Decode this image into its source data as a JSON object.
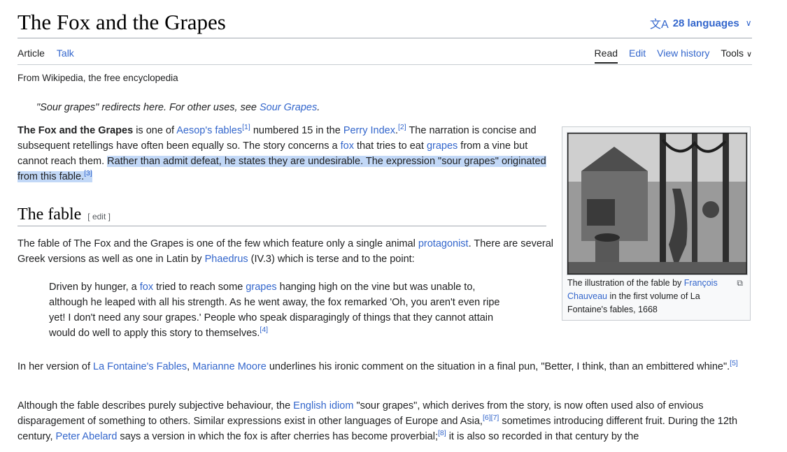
{
  "article": {
    "title": "The Fox and the Grapes",
    "languages_label": "28 languages",
    "tagline": "From Wikipedia, the free encyclopedia"
  },
  "tabs": {
    "article": "Article",
    "talk": "Talk",
    "read": "Read",
    "edit": "Edit",
    "view_history": "View history",
    "tools": "Tools"
  },
  "hatnote": {
    "prefix": "\"Sour grapes\" redirects here. For other uses, see ",
    "link": "Sour Grapes",
    "suffix": "."
  },
  "lead": {
    "bold": "The Fox and the Grapes",
    "t1": " is one of ",
    "l1": "Aesop's fables",
    "r1": "[1]",
    "t2": " numbered 15 in the ",
    "l2": "Perry Index",
    "r2": "[2]",
    "t3": " The narration is concise and subsequent retellings have often been equally so. The story concerns a ",
    "l3": "fox",
    "t4": " that tries to eat ",
    "l4": "grapes",
    "t5": " from a vine but cannot reach them. ",
    "highlight": "Rather than admit defeat, he states they are undesirable. The expression \"sour grapes\" originated from this fable.",
    "r3": "[3]"
  },
  "section": {
    "heading": "The fable",
    "edit_label": "[ edit ]"
  },
  "p2": {
    "t1": "The fable of The Fox and the Grapes is one of the few which feature only a single animal ",
    "l1": "protagonist",
    "t2": ". There are several Greek versions as well as one in Latin by ",
    "l2": "Phaedrus",
    "t3": " (IV.3) which is terse and to the point:"
  },
  "quote": {
    "t1": "Driven by hunger, a ",
    "l1": "fox",
    "t2": " tried to reach some ",
    "l2": "grapes",
    "t3": " hanging high on the vine but was unable to, although he leaped with all his strength. As he went away, the fox remarked 'Oh, you aren't even ripe yet! I don't need any sour grapes.' People who speak disparagingly of things that they cannot attain would do well to apply this story to themselves.",
    "r1": "[4]"
  },
  "p3": {
    "t1": "In her version of ",
    "l1": "La Fontaine's Fables",
    "t2": ", ",
    "l2": "Marianne Moore",
    "t3": " underlines his ironic comment on the situation in a final pun, \"Better, I think, than an embittered whine\".",
    "r1": "[5]"
  },
  "p4": {
    "t1": "Although the fable describes purely subjective behaviour, the ",
    "l1": "English idiom",
    "t2": " \"sour grapes\", which derives from the story, is now often used also of envious disparagement of something to others. Similar expressions exist in other languages of Europe and Asia,",
    "r1": "[6]",
    "r2": "[7]",
    "t3": " sometimes introducing different fruit. During the 12th century, ",
    "l2": "Peter Abelard",
    "t4": " says a version in which the fox is after cherries has become proverbial;",
    "r3": "[8]",
    "t5": " it is also so recorded in that century by the"
  },
  "infobox": {
    "caption_t1": "The illustration of the fable by ",
    "caption_link": "François Chauveau",
    "caption_t2": " in the first volume of La Fontaine's fables, 1668"
  },
  "colors": {
    "link": "#3366cc",
    "highlight": "#c2d8f7",
    "rule": "#a2a9b1"
  }
}
